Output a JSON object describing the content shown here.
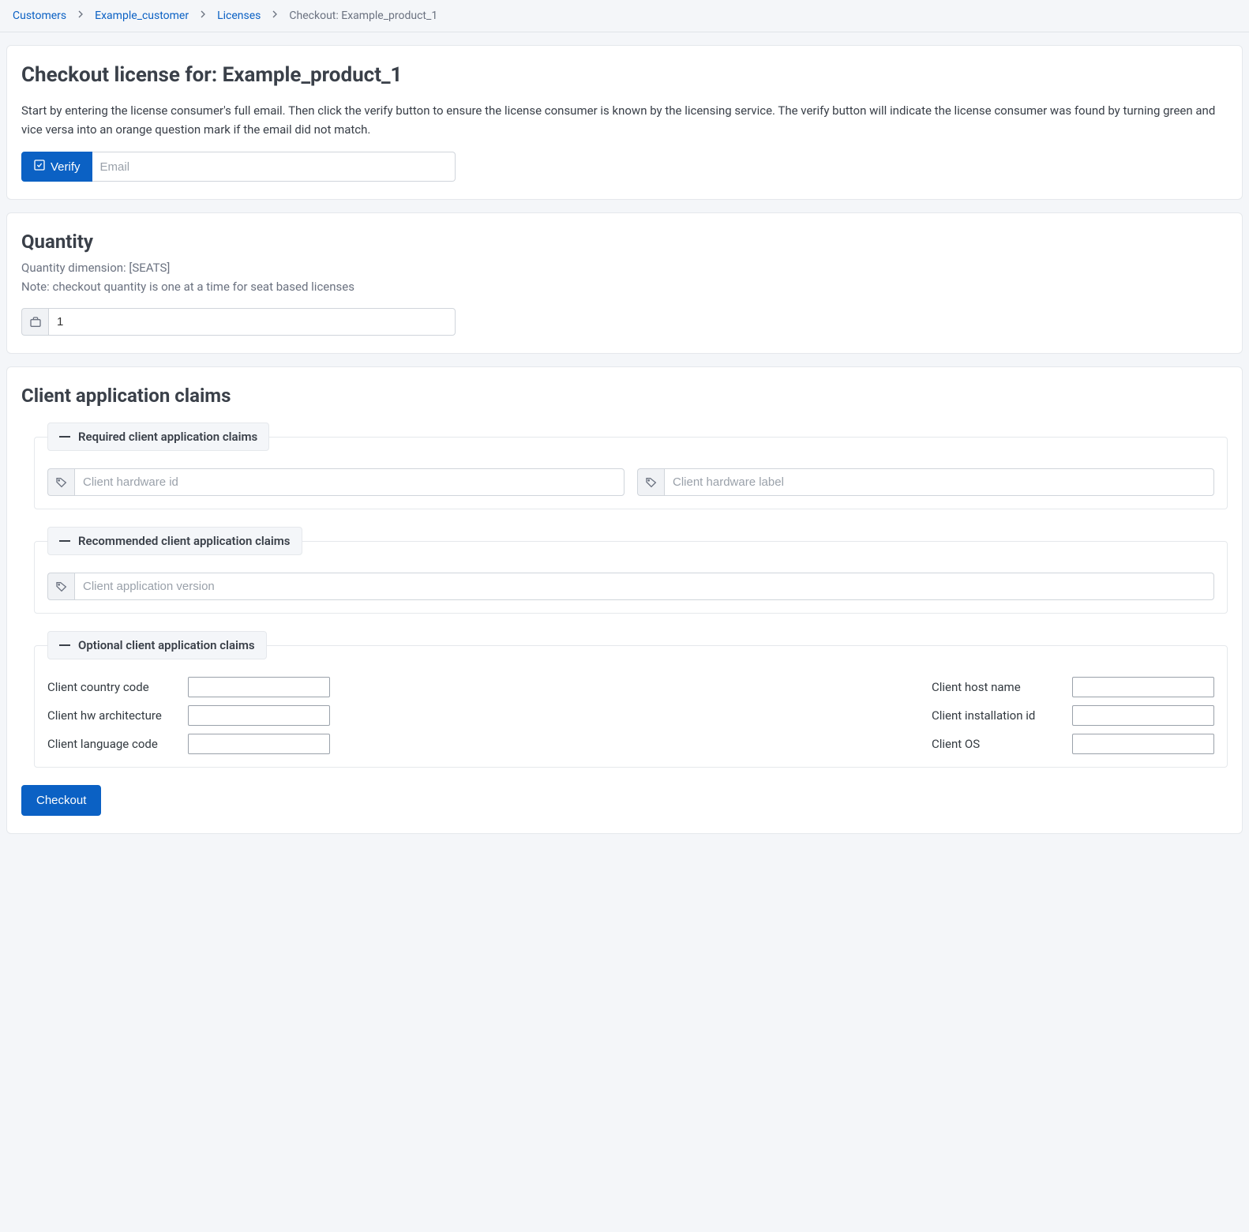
{
  "breadcrumb": {
    "items": [
      {
        "label": "Customers"
      },
      {
        "label": "Example_customer"
      },
      {
        "label": "Licenses"
      }
    ],
    "current": "Checkout: Example_product_1"
  },
  "section_checkout": {
    "title": "Checkout license for: Example_product_1",
    "description": "Start by entering the license consumer's full email. Then click the verify button to ensure the license consumer is known by the licensing service. The verify button will indicate the license consumer was found by turning green and vice versa into an orange question mark if the email did not match.",
    "verify_label": "Verify",
    "email_placeholder": "Email"
  },
  "section_quantity": {
    "title": "Quantity",
    "dimension_text": "Quantity dimension: [SEATS]",
    "note_text": "Note: checkout quantity is one at a time for seat based licenses",
    "value": "1"
  },
  "section_claims": {
    "title": "Client application claims",
    "required": {
      "legend": "Required client application claims",
      "hardware_id_placeholder": "Client hardware id",
      "hardware_label_placeholder": "Client hardware label"
    },
    "recommended": {
      "legend": "Recommended client application claims",
      "app_version_placeholder": "Client application version"
    },
    "optional": {
      "legend": "Optional client application claims",
      "fields": {
        "country_code": "Client country code",
        "hw_arch": "Client hw architecture",
        "language_code": "Client language code",
        "host_name": "Client host name",
        "installation_id": "Client installation id",
        "os": "Client OS"
      }
    },
    "checkout_button": "Checkout"
  }
}
